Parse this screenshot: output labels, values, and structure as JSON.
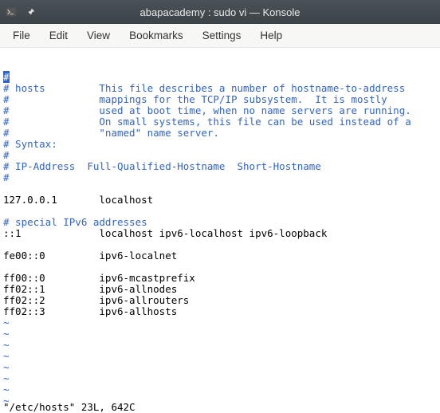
{
  "window": {
    "title": "abapacademy : sudo vi — Konsole"
  },
  "menu": {
    "file": "File",
    "edit": "Edit",
    "view": "View",
    "bookmarks": "Bookmarks",
    "settings": "Settings",
    "help": "Help"
  },
  "terminal": {
    "lines": [
      {
        "cls": "cursor",
        "text": "#"
      },
      {
        "cls": "comment",
        "text": "# hosts         This file describes a number of hostname-to-address"
      },
      {
        "cls": "comment",
        "text": "#               mappings for the TCP/IP subsystem.  It is mostly"
      },
      {
        "cls": "comment",
        "text": "#               used at boot time, when no name servers are running."
      },
      {
        "cls": "comment",
        "text": "#               On small systems, this file can be used instead of a"
      },
      {
        "cls": "comment",
        "text": "#               \"named\" name server."
      },
      {
        "cls": "comment",
        "text": "# Syntax:"
      },
      {
        "cls": "comment",
        "text": "#"
      },
      {
        "cls": "comment",
        "text": "# IP-Address  Full-Qualified-Hostname  Short-Hostname"
      },
      {
        "cls": "comment",
        "text": "#"
      },
      {
        "cls": "plain",
        "text": ""
      },
      {
        "cls": "plain",
        "text": "127.0.0.1       localhost"
      },
      {
        "cls": "plain",
        "text": ""
      },
      {
        "cls": "comment",
        "text": "# special IPv6 addresses"
      },
      {
        "cls": "plain",
        "text": "::1             localhost ipv6-localhost ipv6-loopback"
      },
      {
        "cls": "plain",
        "text": ""
      },
      {
        "cls": "plain",
        "text": "fe00::0         ipv6-localnet"
      },
      {
        "cls": "plain",
        "text": ""
      },
      {
        "cls": "plain",
        "text": "ff00::0         ipv6-mcastprefix"
      },
      {
        "cls": "plain",
        "text": "ff02::1         ipv6-allnodes"
      },
      {
        "cls": "plain",
        "text": "ff02::2         ipv6-allrouters"
      },
      {
        "cls": "plain",
        "text": "ff02::3         ipv6-allhosts"
      },
      {
        "cls": "tilde",
        "text": "~"
      },
      {
        "cls": "tilde",
        "text": "~"
      },
      {
        "cls": "tilde",
        "text": "~"
      },
      {
        "cls": "tilde",
        "text": "~"
      },
      {
        "cls": "tilde",
        "text": "~"
      },
      {
        "cls": "tilde",
        "text": "~"
      },
      {
        "cls": "tilde",
        "text": "~"
      },
      {
        "cls": "tilde",
        "text": "~"
      }
    ],
    "status": "\"/etc/hosts\" 23L, 642C"
  }
}
